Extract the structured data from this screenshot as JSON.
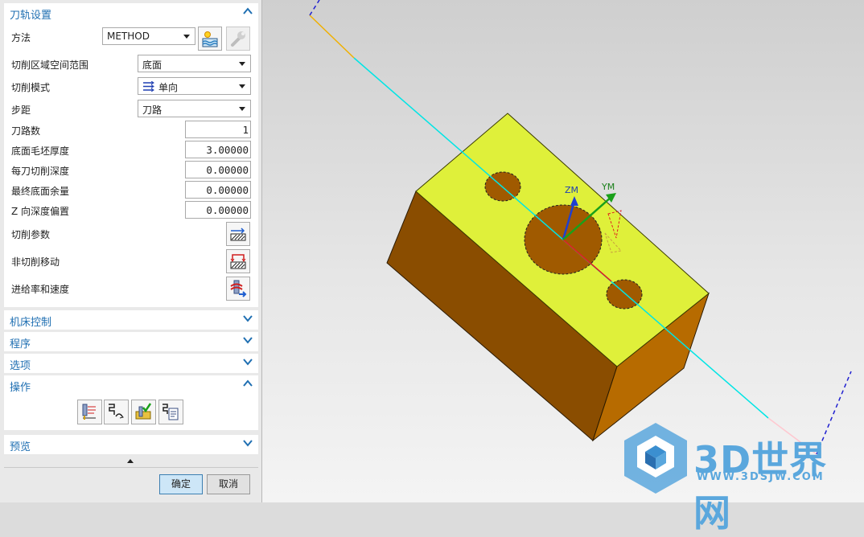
{
  "panel": {
    "path_settings": {
      "title": "刀轨设置",
      "method_label": "方法",
      "method_value": "METHOD",
      "cut_region_label": "切削区域空间范围",
      "cut_region_value": "底面",
      "cut_mode_label": "切削模式",
      "cut_mode_value": "单向",
      "stepover_label": "步距",
      "stepover_value": "刀路",
      "passes_label": "刀路数",
      "passes_value": "1",
      "floor_stock_label": "底面毛坯厚度",
      "floor_stock_value": "3.00000",
      "depth_per_cut_label": "每刀切削深度",
      "depth_per_cut_value": "0.00000",
      "final_floor_stock_label": "最终底面余量",
      "final_floor_stock_value": "0.00000",
      "z_depth_offset_label": "Z 向深度偏置",
      "z_depth_offset_value": "0.00000",
      "cut_params_label": "切削参数",
      "non_cut_moves_label": "非切削移动",
      "feeds_speeds_label": "进给率和速度"
    },
    "machine_control": {
      "title": "机床控制"
    },
    "program": {
      "title": "程序"
    },
    "options": {
      "title": "选项"
    },
    "actions": {
      "title": "操作"
    },
    "preview": {
      "title": "预览"
    },
    "ok_label": "确定",
    "cancel_label": "取消"
  },
  "viewport": {
    "axis_zm": "ZM",
    "axis_ym": "YM",
    "watermark_text": "3D世界网",
    "watermark_url": "WWW.3DSJW.COM"
  },
  "colors": {
    "accent": "#1f6fb2",
    "part_top": "#dff03a",
    "part_side_dark": "#8a4d00",
    "part_side_light": "#b76b00",
    "toolpath": "#00e5e5",
    "watermark": "#5aa7dd"
  }
}
